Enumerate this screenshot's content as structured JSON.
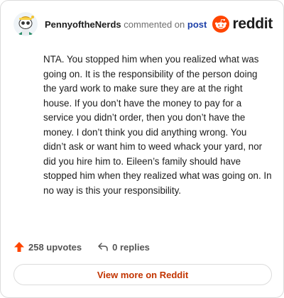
{
  "header": {
    "username": "PennyoftheNerds",
    "action_text": "commented on",
    "post_link": "post",
    "brand_name": "reddit"
  },
  "comment": {
    "text": "NTA. You stopped him when you realized what was going on. It is the responsibility of the person doing the yard work to make sure they are at the right house. If you don’t have the money to pay for a service you didn’t order, then you don’t have the money. I don’t think you did anything wrong. You didn’t ask or want him to weed whack your yard, nor did you hire him to. Eileen’s family should have stopped him when they realized what was going on. In no way is this your responsibility."
  },
  "footer": {
    "upvotes": "258 upvotes",
    "replies": "0 replies",
    "upvote_icon": "upvote-arrow-icon",
    "reply_icon": "reply-arrow-icon"
  },
  "view_more": {
    "label": "View more on Reddit"
  },
  "colors": {
    "reddit_orange": "#ff4500",
    "upvote": "#ff4500",
    "link_blue": "#1c3fa8",
    "view_more_text": "#c23400",
    "border": "#dcdcdc"
  }
}
